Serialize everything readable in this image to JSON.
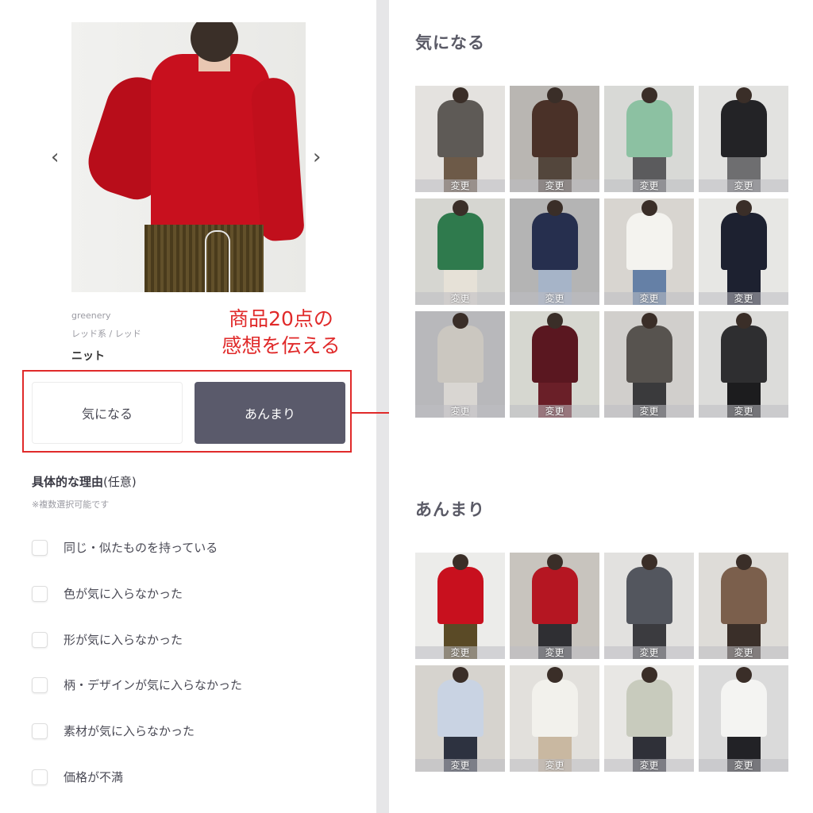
{
  "product": {
    "brand": "greenery",
    "color": "レッド系 / レッド",
    "name": "ニット",
    "prev_arrow": "‹",
    "next_arrow": "›"
  },
  "annotation": {
    "line1": "商品20点の",
    "line2": "感想を伝える",
    "color": "#e02a2a"
  },
  "choices": {
    "like": "気になる",
    "meh": "あんまり"
  },
  "reasons": {
    "title": "具体的な理由",
    "title_optional": "(任意)",
    "note": "※複数選択可能です",
    "items": [
      "同じ・似たものを持っている",
      "色が気に入らなかった",
      "形が気に入らなかった",
      "柄・デザインが気に入らなかった",
      "素材が気に入らなかった",
      "価格が不満"
    ]
  },
  "like_section": {
    "title": "気になる",
    "change_label": "変更",
    "items": [
      {
        "top": "#5e5a56",
        "bottom": "#6d5a48",
        "bg": "#e4e2df"
      },
      {
        "top": "#4a3128",
        "bottom": "#53463c",
        "bg": "#b9b6b2"
      },
      {
        "top": "#8cc1a2",
        "bottom": "#5b5b5d",
        "bg": "#d8d9d6"
      },
      {
        "top": "#232326",
        "bottom": "#6e6e70",
        "bg": "#e2e2e0"
      },
      {
        "top": "#2f7a4d",
        "bottom": "#e6e1d7",
        "bg": "#d6d6d1"
      },
      {
        "top": "#262f4e",
        "bottom": "#a6b4c8",
        "bg": "#b4b4b4"
      },
      {
        "top": "#f4f3ef",
        "bottom": "#6580a6",
        "bg": "#d8d5d0"
      },
      {
        "top": "#1d2130",
        "bottom": "#1d2130",
        "bg": "#e7e7e4"
      },
      {
        "top": "#cbc7c0",
        "bottom": "#d9d6d2",
        "bg": "#b8b8bb"
      },
      {
        "top": "#5a1720",
        "bottom": "#6a1f28",
        "bg": "#d6d7d0"
      },
      {
        "top": "#57534f",
        "bottom": "#3a3a3c",
        "bg": "#d1cfcc"
      },
      {
        "top": "#2e2e30",
        "bottom": "#1c1c1e",
        "bg": "#dcdcda"
      }
    ]
  },
  "meh_section": {
    "title": "あんまり",
    "change_label": "変更",
    "items": [
      {
        "top": "#c8101e",
        "bottom": "#5a4a26",
        "bg": "#ececea"
      },
      {
        "top": "#b51622",
        "bottom": "#2f2f33",
        "bg": "#c8c4be"
      },
      {
        "top": "#53565e",
        "bottom": "#3b3b3f",
        "bg": "#e2e1df"
      },
      {
        "top": "#7b5f4c",
        "bottom": "#3a2f29",
        "bg": "#dedcd8"
      },
      {
        "top": "#c9d3e3",
        "bottom": "#2d3240",
        "bg": "#d6d3ce"
      },
      {
        "top": "#f2f1ec",
        "bottom": "#c9b8a1",
        "bg": "#e2e0dc"
      },
      {
        "top": "#c8cbbd",
        "bottom": "#2f3038",
        "bg": "#e8e7e4"
      },
      {
        "top": "#f4f4f2",
        "bottom": "#222226",
        "bg": "#dadada"
      }
    ]
  }
}
